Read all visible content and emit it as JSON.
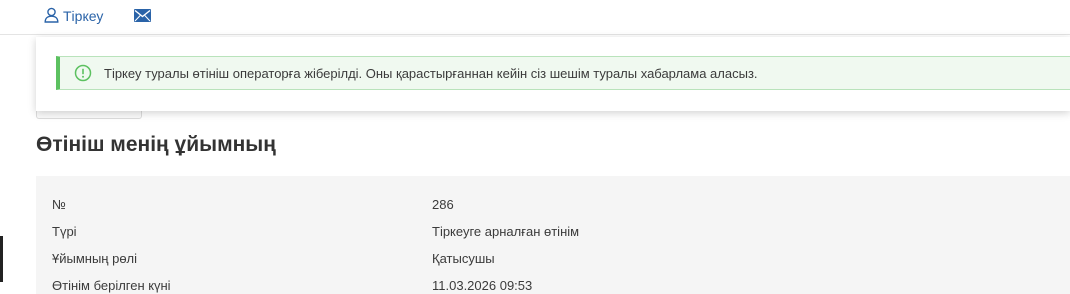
{
  "nav": {
    "register_label": "Тіркеу",
    "register_icon": "user-icon",
    "mail_icon": "envelope-icon",
    "link_color": "#2a63a8"
  },
  "notice": {
    "icon": "info-circle-icon",
    "text": "Тіркеу туралы өтініш операторға жіберілді. Оны қарастырғаннан кейін сіз шешім туралы хабарлама аласыз.",
    "status_color": "#5cc160"
  },
  "page": {
    "title": "Өтініш менің ұйымның"
  },
  "details": {
    "rows": [
      {
        "label": "№",
        "value": "286"
      },
      {
        "label": "Түрі",
        "value": "Тіркеуге арналған өтінім"
      },
      {
        "label": "Ұйымның рөлі",
        "value": "Қатысушы"
      },
      {
        "label": "Өтінім берілген күні",
        "value": "11.03.2026 09:53"
      }
    ]
  }
}
